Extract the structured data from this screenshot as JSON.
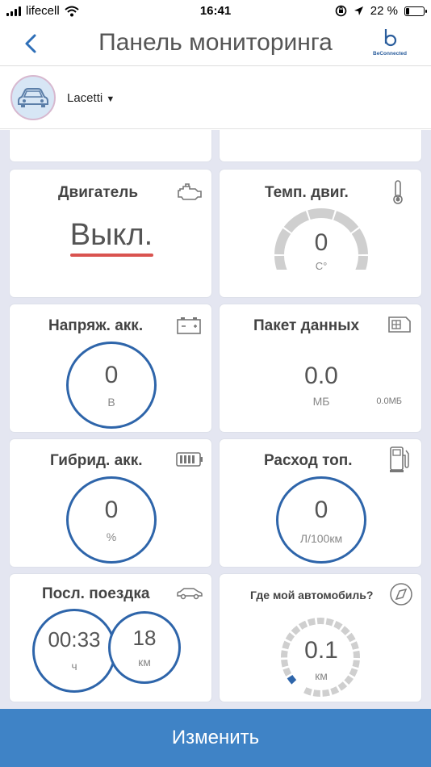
{
  "status_bar": {
    "carrier": "lifecell",
    "time": "16:41",
    "battery_percent": "22 %",
    "battery_level": 0.22
  },
  "nav": {
    "title": "Панель мониторинга",
    "brand": "BeConnected"
  },
  "car_selector": {
    "car_name": "Lacetti"
  },
  "tiles": {
    "engine": {
      "title": "Двигатель",
      "value": "Выкл.",
      "accent_color": "#d9534f"
    },
    "engine_temp": {
      "title": "Темп. двиг.",
      "value": "0",
      "unit": "C°"
    },
    "battery_voltage": {
      "title": "Напряж. акк.",
      "value": "0",
      "unit": "В"
    },
    "data_package": {
      "title": "Пакет данных",
      "value": "0.0",
      "unit": "МБ",
      "secondary": "0.0МБ"
    },
    "hybrid_battery": {
      "title": "Гибрид. акк.",
      "value": "0",
      "unit": "%"
    },
    "fuel_consumption": {
      "title": "Расход топ.",
      "value": "0",
      "unit": "Л/100км"
    },
    "last_trip": {
      "title": "Посл. поездка",
      "duration_value": "00:33",
      "duration_unit": "ч",
      "distance_value": "18",
      "distance_unit": "км"
    },
    "car_location": {
      "title": "Где мой автомобиль?",
      "value": "0.1",
      "unit": "км",
      "level": 0.04
    }
  },
  "footer": {
    "edit_label": "Изменить"
  },
  "colors": {
    "accent": "#2e65aa",
    "button": "#3f83c6",
    "background": "#e4e6f1"
  }
}
